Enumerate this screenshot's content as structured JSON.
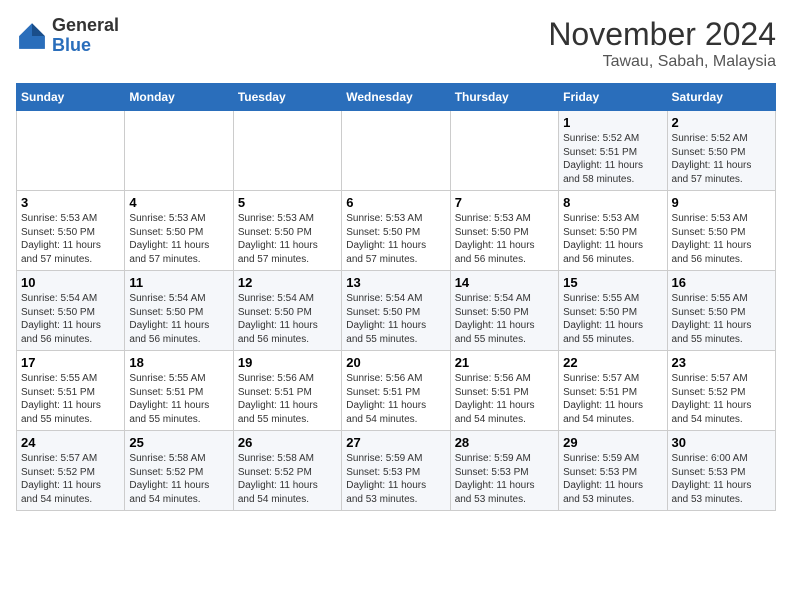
{
  "logo": {
    "general": "General",
    "blue": "Blue"
  },
  "title": "November 2024",
  "subtitle": "Tawau, Sabah, Malaysia",
  "days": [
    "Sunday",
    "Monday",
    "Tuesday",
    "Wednesday",
    "Thursday",
    "Friday",
    "Saturday"
  ],
  "weeks": [
    [
      {
        "day": "",
        "info": ""
      },
      {
        "day": "",
        "info": ""
      },
      {
        "day": "",
        "info": ""
      },
      {
        "day": "",
        "info": ""
      },
      {
        "day": "",
        "info": ""
      },
      {
        "day": "1",
        "info": "Sunrise: 5:52 AM\nSunset: 5:51 PM\nDaylight: 11 hours\nand 58 minutes."
      },
      {
        "day": "2",
        "info": "Sunrise: 5:52 AM\nSunset: 5:50 PM\nDaylight: 11 hours\nand 57 minutes."
      }
    ],
    [
      {
        "day": "3",
        "info": "Sunrise: 5:53 AM\nSunset: 5:50 PM\nDaylight: 11 hours\nand 57 minutes."
      },
      {
        "day": "4",
        "info": "Sunrise: 5:53 AM\nSunset: 5:50 PM\nDaylight: 11 hours\nand 57 minutes."
      },
      {
        "day": "5",
        "info": "Sunrise: 5:53 AM\nSunset: 5:50 PM\nDaylight: 11 hours\nand 57 minutes."
      },
      {
        "day": "6",
        "info": "Sunrise: 5:53 AM\nSunset: 5:50 PM\nDaylight: 11 hours\nand 57 minutes."
      },
      {
        "day": "7",
        "info": "Sunrise: 5:53 AM\nSunset: 5:50 PM\nDaylight: 11 hours\nand 56 minutes."
      },
      {
        "day": "8",
        "info": "Sunrise: 5:53 AM\nSunset: 5:50 PM\nDaylight: 11 hours\nand 56 minutes."
      },
      {
        "day": "9",
        "info": "Sunrise: 5:53 AM\nSunset: 5:50 PM\nDaylight: 11 hours\nand 56 minutes."
      }
    ],
    [
      {
        "day": "10",
        "info": "Sunrise: 5:54 AM\nSunset: 5:50 PM\nDaylight: 11 hours\nand 56 minutes."
      },
      {
        "day": "11",
        "info": "Sunrise: 5:54 AM\nSunset: 5:50 PM\nDaylight: 11 hours\nand 56 minutes."
      },
      {
        "day": "12",
        "info": "Sunrise: 5:54 AM\nSunset: 5:50 PM\nDaylight: 11 hours\nand 56 minutes."
      },
      {
        "day": "13",
        "info": "Sunrise: 5:54 AM\nSunset: 5:50 PM\nDaylight: 11 hours\nand 55 minutes."
      },
      {
        "day": "14",
        "info": "Sunrise: 5:54 AM\nSunset: 5:50 PM\nDaylight: 11 hours\nand 55 minutes."
      },
      {
        "day": "15",
        "info": "Sunrise: 5:55 AM\nSunset: 5:50 PM\nDaylight: 11 hours\nand 55 minutes."
      },
      {
        "day": "16",
        "info": "Sunrise: 5:55 AM\nSunset: 5:50 PM\nDaylight: 11 hours\nand 55 minutes."
      }
    ],
    [
      {
        "day": "17",
        "info": "Sunrise: 5:55 AM\nSunset: 5:51 PM\nDaylight: 11 hours\nand 55 minutes."
      },
      {
        "day": "18",
        "info": "Sunrise: 5:55 AM\nSunset: 5:51 PM\nDaylight: 11 hours\nand 55 minutes."
      },
      {
        "day": "19",
        "info": "Sunrise: 5:56 AM\nSunset: 5:51 PM\nDaylight: 11 hours\nand 55 minutes."
      },
      {
        "day": "20",
        "info": "Sunrise: 5:56 AM\nSunset: 5:51 PM\nDaylight: 11 hours\nand 54 minutes."
      },
      {
        "day": "21",
        "info": "Sunrise: 5:56 AM\nSunset: 5:51 PM\nDaylight: 11 hours\nand 54 minutes."
      },
      {
        "day": "22",
        "info": "Sunrise: 5:57 AM\nSunset: 5:51 PM\nDaylight: 11 hours\nand 54 minutes."
      },
      {
        "day": "23",
        "info": "Sunrise: 5:57 AM\nSunset: 5:52 PM\nDaylight: 11 hours\nand 54 minutes."
      }
    ],
    [
      {
        "day": "24",
        "info": "Sunrise: 5:57 AM\nSunset: 5:52 PM\nDaylight: 11 hours\nand 54 minutes."
      },
      {
        "day": "25",
        "info": "Sunrise: 5:58 AM\nSunset: 5:52 PM\nDaylight: 11 hours\nand 54 minutes."
      },
      {
        "day": "26",
        "info": "Sunrise: 5:58 AM\nSunset: 5:52 PM\nDaylight: 11 hours\nand 54 minutes."
      },
      {
        "day": "27",
        "info": "Sunrise: 5:59 AM\nSunset: 5:53 PM\nDaylight: 11 hours\nand 53 minutes."
      },
      {
        "day": "28",
        "info": "Sunrise: 5:59 AM\nSunset: 5:53 PM\nDaylight: 11 hours\nand 53 minutes."
      },
      {
        "day": "29",
        "info": "Sunrise: 5:59 AM\nSunset: 5:53 PM\nDaylight: 11 hours\nand 53 minutes."
      },
      {
        "day": "30",
        "info": "Sunrise: 6:00 AM\nSunset: 5:53 PM\nDaylight: 11 hours\nand 53 minutes."
      }
    ]
  ]
}
